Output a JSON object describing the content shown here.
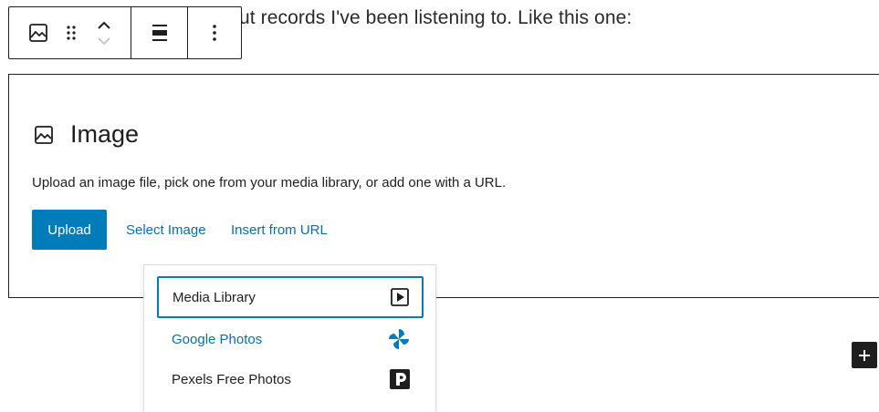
{
  "paragraph": {
    "text": "ut records I've been listening to. Like this one:"
  },
  "toolbar": {
    "block_type_icon": "image-icon",
    "drag_icon": "drag-handle-icon",
    "move_up_icon": "chevron-up-icon",
    "move_down_icon": "chevron-down-icon",
    "align_icon": "align-center-icon",
    "more_icon": "more-vertical-icon"
  },
  "image_block": {
    "icon": "image-icon",
    "title": "Image",
    "instructions": "Upload an image file, pick one from your media library, or add one with a URL.",
    "upload_label": "Upload",
    "select_image_label": "Select Image",
    "insert_url_label": "Insert from URL"
  },
  "dropdown": {
    "items": [
      {
        "label": "Media Library",
        "icon": "media-library-icon"
      },
      {
        "label": "Google Photos",
        "icon": "google-photos-icon"
      },
      {
        "label": "Pexels Free Photos",
        "icon": "pexels-icon"
      }
    ]
  },
  "inserter": {
    "icon": "plus-icon"
  },
  "colors": {
    "accent": "#007cba",
    "link": "#0a6fa8",
    "text": "#1e1e1e",
    "border": "#1e1e1e"
  }
}
